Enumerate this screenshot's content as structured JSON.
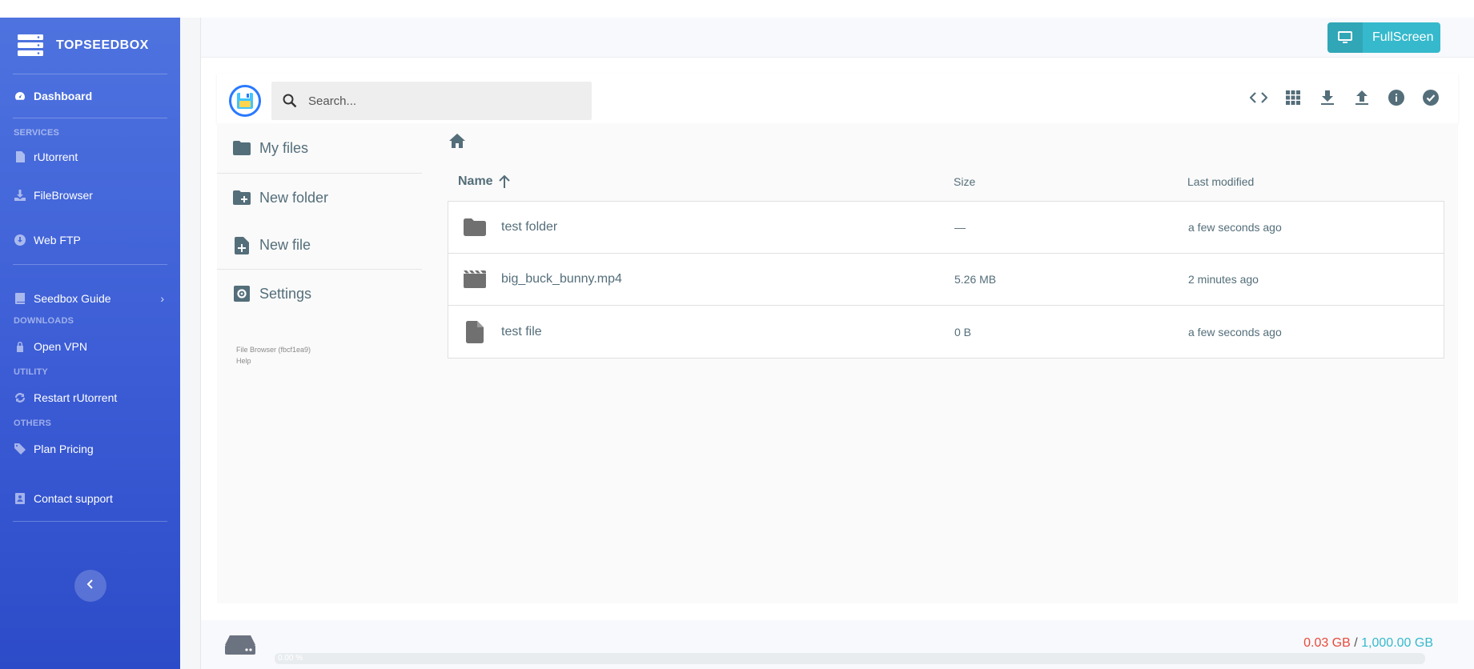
{
  "brand": {
    "name": "TOPSEEDBOX"
  },
  "sidebar": {
    "dashboard": "Dashboard",
    "section_services": "SERVICES",
    "rutorrent": "rUtorrent",
    "filebrowser": "FileBrowser",
    "webftp": "Web FTP",
    "seedbox_guide": "Seedbox Guide",
    "section_downloads": "DOWNLOADS",
    "openvpn": "Open VPN",
    "section_utility": "UTILITY",
    "restart_rutorrent": "Restart rUtorrent",
    "section_others": "OTHERS",
    "plan_pricing": "Plan Pricing",
    "contact_support": "Contact support"
  },
  "topbar": {
    "fullscreen_label": "FullScreen"
  },
  "search": {
    "placeholder": "Search..."
  },
  "fb_sidebar": {
    "my_files": "My files",
    "new_folder": "New folder",
    "new_file": "New file",
    "settings": "Settings",
    "version": "File Browser (fbcf1ea9)",
    "help": "Help"
  },
  "listing": {
    "headers": {
      "name": "Name",
      "size": "Size",
      "modified": "Last modified"
    },
    "rows": [
      {
        "name": "test folder",
        "size": "—",
        "modified": "a few seconds ago",
        "icon": "folder-icon"
      },
      {
        "name": "big_buck_bunny.mp4",
        "size": "5.26 MB",
        "modified": "2 minutes ago",
        "icon": "movie-icon"
      },
      {
        "name": "test file",
        "size": "0 B",
        "modified": "a few seconds ago",
        "icon": "file-icon"
      }
    ]
  },
  "storage": {
    "used": "0.03 GB",
    "separator": "/",
    "total": "1,000.00 GB",
    "percent_label": "0.00 %",
    "fraction": 0.0
  },
  "colors": {
    "sidebar": "#4e73df",
    "accent_teal": "#36b9cc",
    "danger": "#e74a3b",
    "fb_blue": "#2979ff"
  }
}
